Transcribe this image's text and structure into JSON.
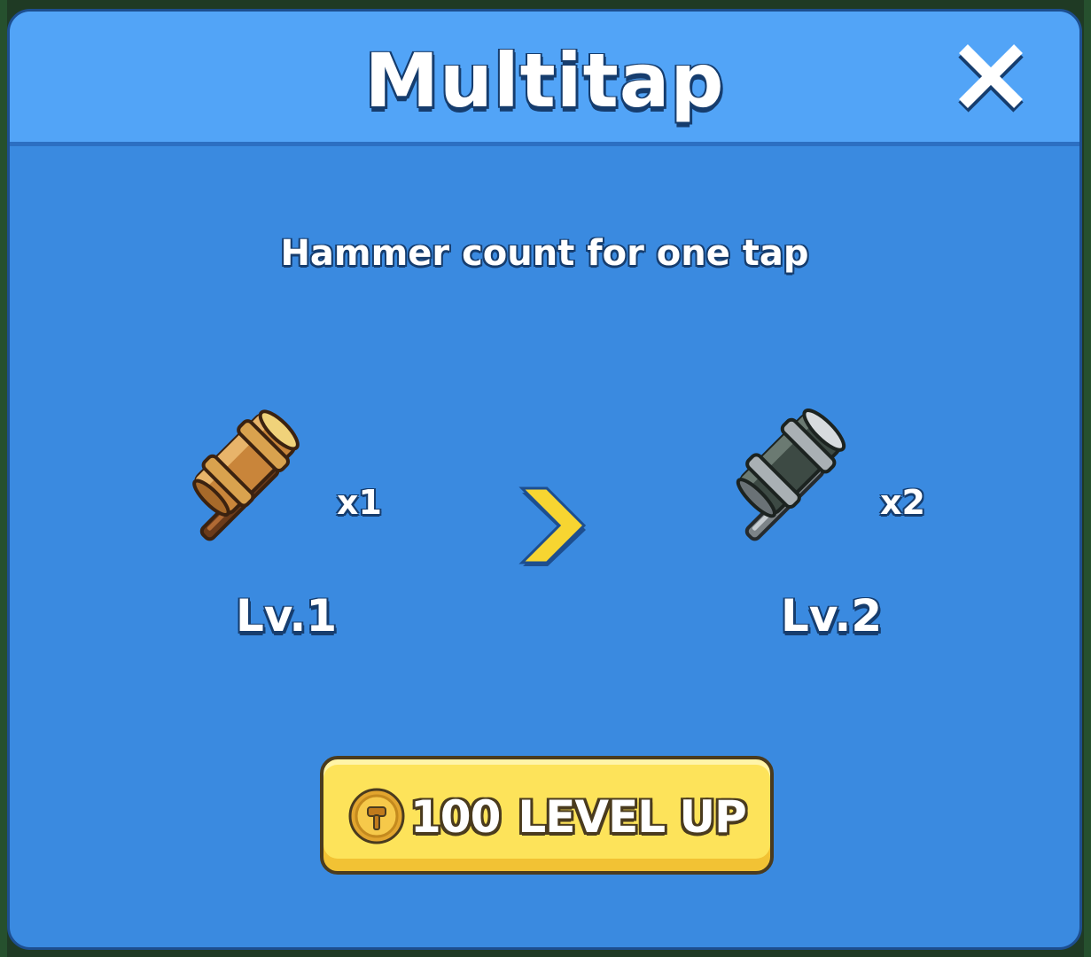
{
  "modal": {
    "title": "Multitap",
    "subtitle": "Hammer count for one tap",
    "close_icon": "close-icon"
  },
  "current_level": {
    "label": "Lv.1",
    "multiplier": "x1",
    "icon": "bronze-hammer-icon"
  },
  "next_level": {
    "label": "Lv.2",
    "multiplier": "x2",
    "icon": "steel-hammer-icon"
  },
  "arrow_icon": "chevron-right-icon",
  "level_up_button": {
    "cost": "100",
    "label": "LEVEL UP",
    "icon": "hammer-coin-icon"
  },
  "colors": {
    "modal_background": "#3a8ae0",
    "header_background": "#52a4f7",
    "button_background": "#fde35a",
    "arrow": "#f7d531",
    "text_outline": "#163d6e"
  }
}
